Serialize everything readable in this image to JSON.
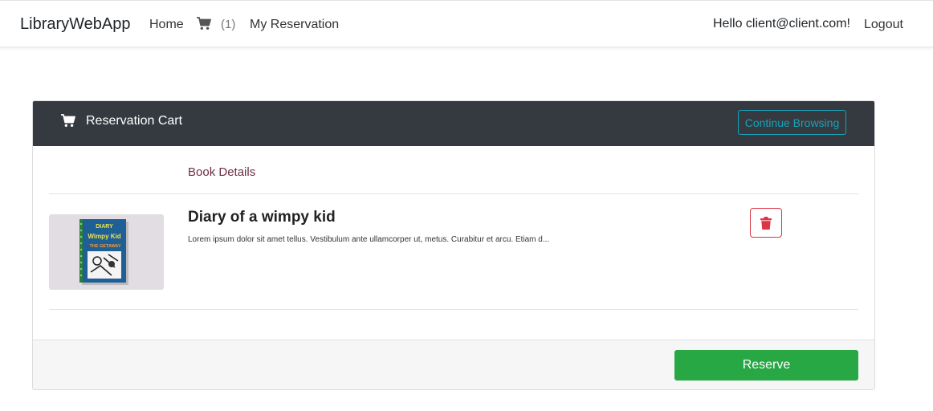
{
  "navbar": {
    "brand": "LibraryWebApp",
    "home": "Home",
    "cart_icon": "cart-icon",
    "cart_count": "(1)",
    "my_reservation": "My Reservation",
    "greeting": "Hello client@client.com!",
    "logout": "Logout"
  },
  "cart": {
    "icon": "cart-icon",
    "title": "Reservation Cart",
    "continue_label": "Continue Browsing",
    "column_header": "Book Details",
    "items": [
      {
        "title": "Diary of a wimpy kid",
        "description": "Lorem ipsum dolor sit amet tellus. Vestibulum ante ullamcorper ut, metus. Curabitur et arcu. Etiam d...",
        "cover_text": [
          "DIARY",
          "Wimpy Kid",
          "THE GETAWAY"
        ],
        "delete_icon": "trash-icon"
      }
    ],
    "reserve_label": "Reserve"
  },
  "colors": {
    "header_bg": "#343a40",
    "info": "#17a2b8",
    "danger": "#dc3545",
    "success": "#28a745"
  }
}
